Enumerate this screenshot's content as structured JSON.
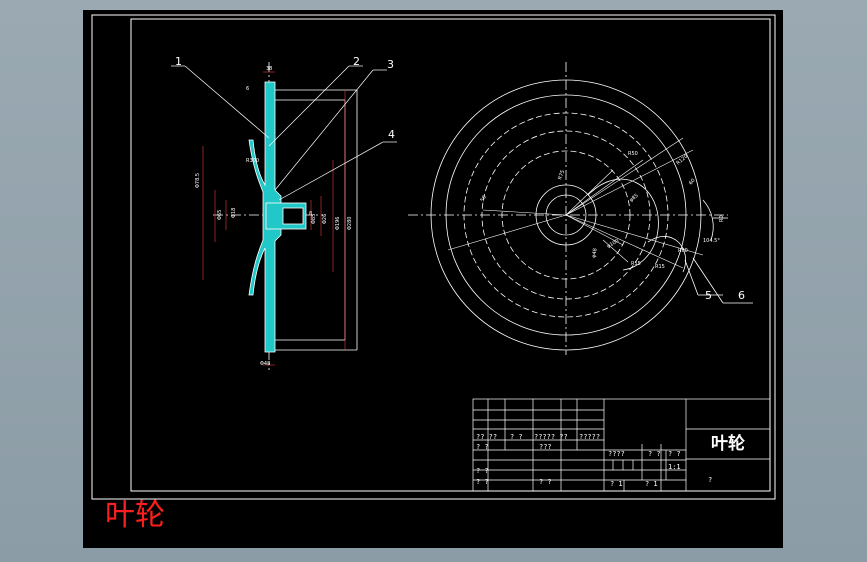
{
  "caption": "叶轮",
  "title_block": {
    "part_name": "叶轮",
    "cells": [
      "?? ??",
      "? ?",
      "????? ??",
      "?????",
      "? ?",
      "???",
      "? ?",
      "? ?",
      "? ?",
      "????",
      "? ?",
      "? ?",
      "1:1",
      "? 1",
      "? 1",
      "?"
    ]
  },
  "callouts": [
    "1",
    "2",
    "3",
    "4",
    "5",
    "6"
  ],
  "side_view_dims": [
    "38",
    "6",
    "R300",
    "Φ78.5",
    "Φ65",
    "Φ18",
    "Φ196",
    "Φ280",
    "Φ85",
    "8",
    "Φ26",
    "Φ48"
  ],
  "front_view_dims": [
    "R120",
    "R50",
    "R75",
    "φ100",
    "φ85",
    "50",
    "φ48",
    "60",
    "R15",
    "R15",
    "R60",
    "R0",
    "104.5°"
  ],
  "colors": {
    "sheet": "#000000",
    "lines": "#ffffff",
    "section_fill": "#22c8c8",
    "caption": "#ff1e1e",
    "window": "#8e9ea8"
  }
}
